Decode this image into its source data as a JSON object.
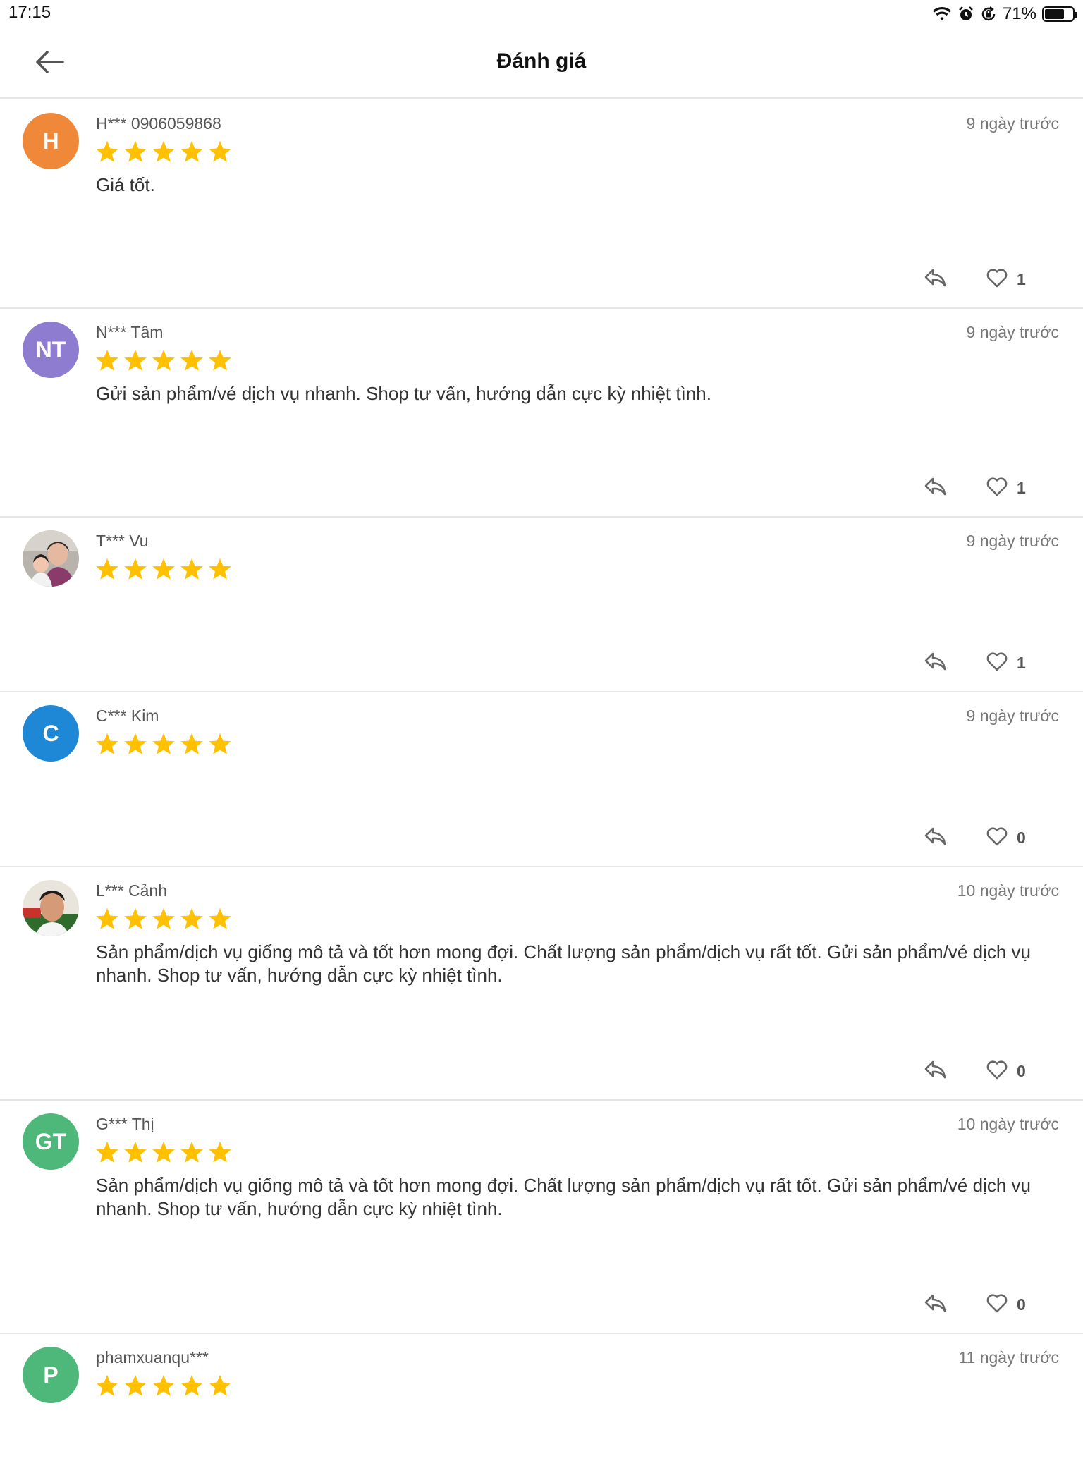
{
  "status_bar": {
    "time": "17:15",
    "battery": "71%",
    "battery_level": 0.71,
    "icons": [
      "wifi-icon",
      "alarm-icon",
      "rotation-lock-icon",
      "battery-icon"
    ]
  },
  "header": {
    "title": "Đánh giá",
    "back_icon": "arrow-left-icon"
  },
  "colors": {
    "star": "#FFC000",
    "avatar_orange": "#F0883A",
    "avatar_purple": "#8E7CD0",
    "avatar_blue": "#1E88D6",
    "avatar_green": "#4DB87A",
    "divider": "#E6E6E6"
  },
  "reviews": [
    {
      "initials": "H",
      "avatar_color": "#F0883A",
      "name": "H*** 0906059868",
      "time": "9 ngày trước",
      "rating": 5,
      "text": "Giá tốt.",
      "likes": "1"
    },
    {
      "initials": "NT",
      "avatar_color": "#8E7CD0",
      "name": "N*** Tâm",
      "time": "9 ngày trước",
      "rating": 5,
      "text": "Gửi sản phẩm/vé dịch vụ nhanh. Shop tư vấn, hướng dẫn cực kỳ nhiệt tình.",
      "likes": "1"
    },
    {
      "initials": "",
      "avatar_color": "",
      "name": "T*** Vu",
      "time": "9 ngày trước",
      "rating": 5,
      "text": "",
      "likes": "1"
    },
    {
      "initials": "C",
      "avatar_color": "#1E88D6",
      "name": "C*** Kim",
      "time": "9 ngày trước",
      "rating": 5,
      "text": "",
      "likes": "0"
    },
    {
      "initials": "",
      "avatar_color": "",
      "name": "L*** Cảnh",
      "time": "10 ngày trước",
      "rating": 5,
      "text": "Sản phẩm/dịch vụ giống mô tả và tốt hơn mong đợi. Chất lượng sản phẩm/dịch vụ rất tốt. Gửi sản phẩm/vé dịch vụ nhanh. Shop tư vấn, hướng dẫn cực kỳ nhiệt tình.",
      "likes": "0"
    },
    {
      "initials": "GT",
      "avatar_color": "#4DB87A",
      "name": "G*** Thị",
      "time": "10 ngày trước",
      "rating": 5,
      "text": "Sản phẩm/dịch vụ giống mô tả và tốt hơn mong đợi. Chất lượng sản phẩm/dịch vụ rất tốt. Gửi sản phẩm/vé dịch vụ nhanh. Shop tư vấn, hướng dẫn cực kỳ nhiệt tình.",
      "likes": "0"
    },
    {
      "initials": "P",
      "avatar_color": "#4DB87A",
      "name": "phamxuanqu***",
      "time": "11 ngày trước",
      "rating": 5,
      "text": "",
      "likes": ""
    }
  ]
}
